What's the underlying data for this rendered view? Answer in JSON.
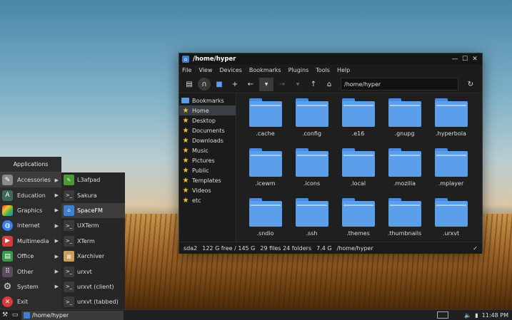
{
  "window": {
    "title": "/home/hyper",
    "menu": [
      "File",
      "View",
      "Devices",
      "Bookmarks",
      "Plugins",
      "Tools",
      "Help"
    ],
    "path_value": "/home/hyper",
    "sidebar": [
      "Bookmarks",
      "Home",
      "Desktop",
      "Documents",
      "Downloads",
      "Music",
      "Pictures",
      "Public",
      "Templates",
      "Videos",
      "etc"
    ],
    "folders": [
      ".cache",
      ".config",
      ".e16",
      ".gnupg",
      ".hyperbola",
      ".icewm",
      ".icons",
      ".local",
      ".mozilla",
      ".mplayer",
      ".sndio",
      ".ssh",
      ".themes",
      ".thumbnails",
      ".urxvt"
    ],
    "status": {
      "device": "sda2",
      "space": "122 G free / 145 G",
      "count": "29 files 24 folders",
      "size": "7.4 G",
      "path": "/home/hyper"
    }
  },
  "appmenu": {
    "header": "Applications",
    "categories": [
      "Accessories",
      "Education",
      "Graphics",
      "Internet",
      "Multimedia",
      "Office",
      "Other",
      "System",
      "Exit"
    ],
    "accessories": [
      "L3afpad",
      "Sakura",
      "SpaceFM",
      "UXTerm",
      "XTerm",
      "Xarchiver",
      "urxvt",
      "urxvt (client)",
      "urxvt (tabbed)"
    ]
  },
  "taskbar": {
    "task_label": "/home/hyper",
    "clock": "11:48 PM"
  },
  "colors": {
    "accent_blue": "#5b9eea",
    "star_yellow": "#f2c230",
    "window_bg": "#1f1f1f"
  }
}
